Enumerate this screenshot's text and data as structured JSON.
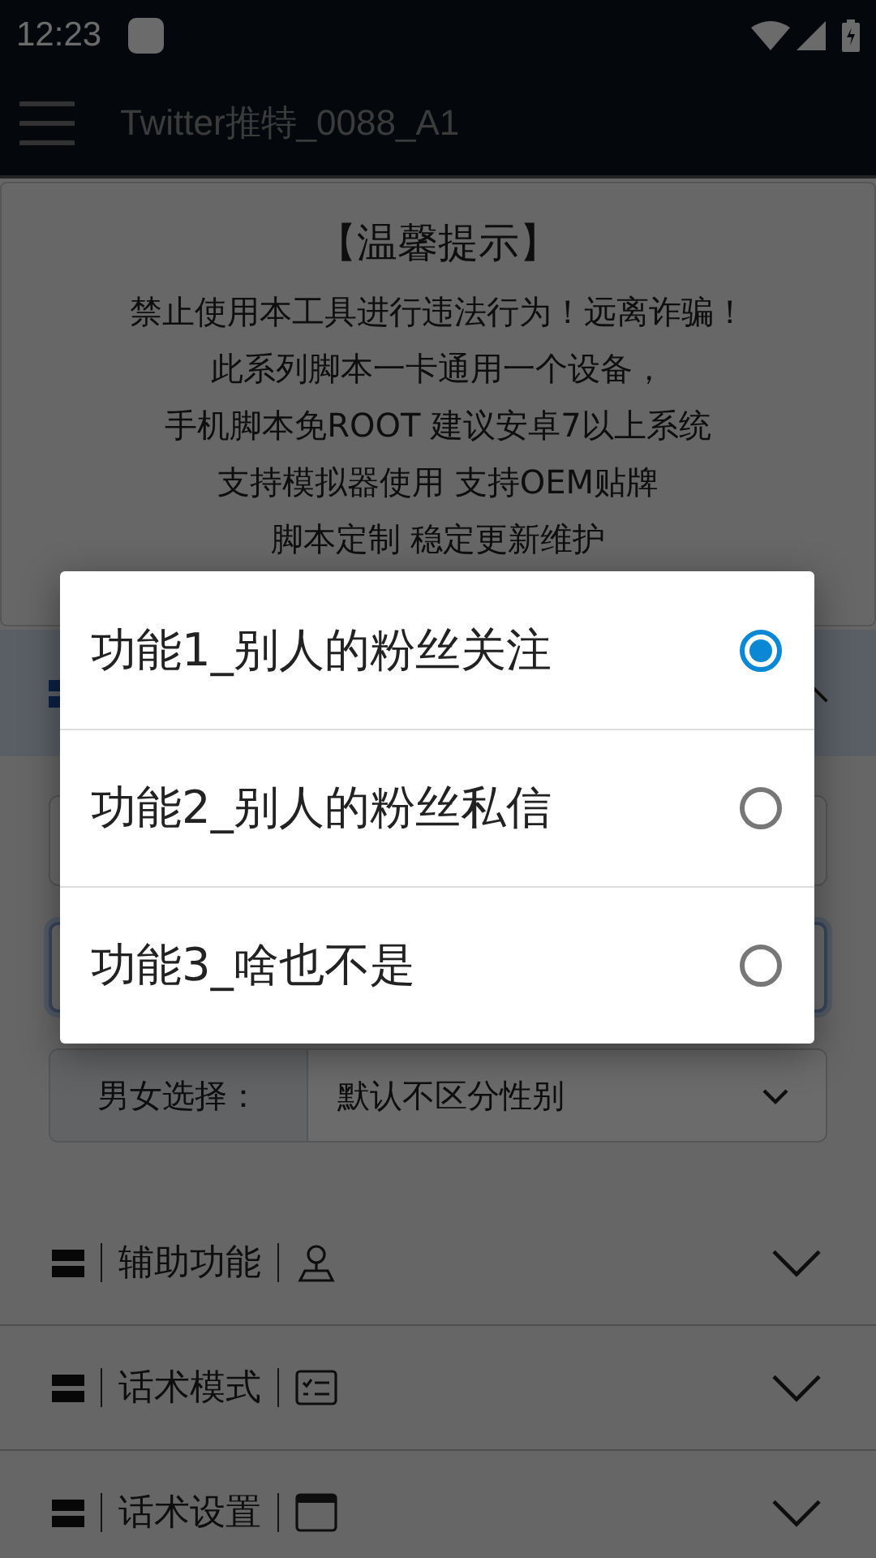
{
  "status_bar": {
    "time": "12:23"
  },
  "app_bar": {
    "title": "Twitter推特_0088_A1"
  },
  "notice": {
    "title": "【温馨提示】",
    "lines": [
      "禁止使用本工具进行违法行为！远离诈骗！",
      "此系列脚本一卡通用一个设备，",
      "手机脚本免ROOT 建议安卓7以上系统",
      "支持模拟器使用 支持OEM贴牌",
      "脚本定制 稳定更新维护"
    ]
  },
  "open_section": {
    "expanded": true
  },
  "gender_select": {
    "label": "男女选择：",
    "value": "默认不区分性别"
  },
  "sections": [
    {
      "title": "辅助功能",
      "expanded": false
    },
    {
      "title": "话术模式",
      "expanded": false
    },
    {
      "title": "话术设置",
      "expanded": false
    }
  ],
  "dialog": {
    "options": [
      {
        "label": "功能1_别人的粉丝关注",
        "selected": true
      },
      {
        "label": "功能2_别人的粉丝私信",
        "selected": false
      },
      {
        "label": "功能3_啥也不是",
        "selected": false
      }
    ]
  }
}
